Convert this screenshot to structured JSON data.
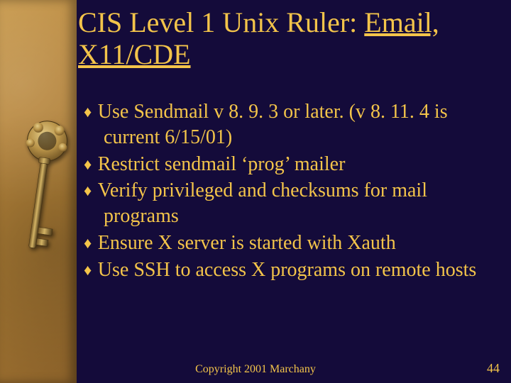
{
  "title": {
    "prefix": "CIS Level 1 Unix Ruler: ",
    "emphasis": "Email, X11/CDE"
  },
  "bullets": [
    "Use Sendmail v 8. 9. 3 or later. (v 8. 11. 4 is current 6/15/01)",
    "Restrict sendmail ‘prog’ mailer",
    "Verify privileged and checksums for mail programs",
    "Ensure X server is started with Xauth",
    "Use SSH to access X programs on remote hosts"
  ],
  "footer": {
    "copyright": "Copyright 2001 Marchany",
    "page": "44"
  },
  "icons": {
    "bullet_glyph": "♦"
  },
  "colors": {
    "background": "#140b3a",
    "accent": "#f3c44a",
    "panel": "#b7863d"
  }
}
